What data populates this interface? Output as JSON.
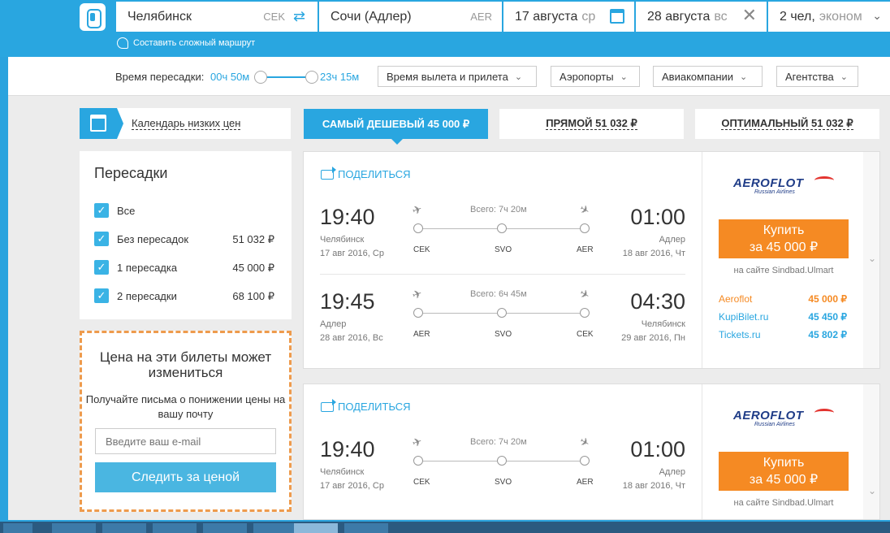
{
  "search": {
    "origin": "Челябинск",
    "origin_code": "CEK",
    "destination": "Сочи (Адлер)",
    "destination_code": "AER",
    "depart_date": "17 августа",
    "depart_day": "ср",
    "return_date": "28 августа",
    "return_day": "вс",
    "passengers": "2 чел,",
    "class": "эконом",
    "complex_route": "Составить сложный маршрут"
  },
  "filters": {
    "transfer_time_label": "Время пересадки:",
    "transfer_min": "00ч 50м",
    "transfer_max": "23ч 15м",
    "dropdowns": [
      "Время вылета и прилета",
      "Аэропорты",
      "Авиакомпании",
      "Агентства"
    ]
  },
  "calendar_link": "Календарь низких цен",
  "tabs": [
    {
      "label": "САМЫЙ ДЕШЕВЫЙ 45 000 ₽",
      "active": true
    },
    {
      "label": "ПРЯМОЙ 51 032 ₽",
      "active": false
    },
    {
      "label": "ОПТИМАЛЬНЫЙ 51 032 ₽",
      "active": false
    }
  ],
  "stops": {
    "title": "Пересадки",
    "items": [
      {
        "label": "Все",
        "price": ""
      },
      {
        "label": "Без пересадок",
        "price": "51 032 ₽"
      },
      {
        "label": "1 пересадка",
        "price": "45 000 ₽"
      },
      {
        "label": "2 пересадки",
        "price": "68 100 ₽"
      }
    ]
  },
  "subscribe": {
    "title": "Цена на эти билеты может измениться",
    "text": "Получайте письма о понижении цены на вашу почту",
    "email_placeholder": "Введите ваш e-mail",
    "button": "Следить за ценой"
  },
  "tickets": [
    {
      "share": "ПОДЕЛИТЬСЯ",
      "segments": [
        {
          "dep_time": "19:40",
          "dep_city": "Челябинск",
          "dep_date": "17 авг 2016, Ср",
          "arr_time": "01:00",
          "arr_city": "Адлер",
          "arr_date": "18 авг 2016, Чт",
          "total": "Всего: 7ч 20м",
          "airports": [
            "CEK",
            "SVO",
            "AER"
          ]
        },
        {
          "dep_time": "19:45",
          "dep_city": "Адлер",
          "dep_date": "28 авг 2016, Вс",
          "arr_time": "04:30",
          "arr_city": "Челябинск",
          "arr_date": "29 авг 2016, Пн",
          "total": "Всего: 6ч 45м",
          "airports": [
            "AER",
            "SVO",
            "CEK"
          ]
        }
      ],
      "airline": "AEROFLOT",
      "airline_sub": "Russian Airlines",
      "buy_line1": "Купить",
      "buy_line2": "за 45 000 ₽",
      "buy_site": "на сайте Sindbad.Ulmart",
      "offers": [
        {
          "agent": "Aeroflot",
          "price": "45 000 ₽"
        },
        {
          "agent": "KupiBilet.ru",
          "price": "45 450 ₽"
        },
        {
          "agent": "Tickets.ru",
          "price": "45 802 ₽"
        }
      ]
    },
    {
      "share": "ПОДЕЛИТЬСЯ",
      "segments": [
        {
          "dep_time": "19:40",
          "dep_city": "Челябинск",
          "dep_date": "17 авг 2016, Ср",
          "arr_time": "01:00",
          "arr_city": "Адлер",
          "arr_date": "18 авг 2016, Чт",
          "total": "Всего: 7ч 20м",
          "airports": [
            "CEK",
            "SVO",
            "AER"
          ]
        }
      ],
      "airline": "AEROFLOT",
      "airline_sub": "Russian Airlines",
      "buy_line1": "Купить",
      "buy_line2": "за 45 000 ₽",
      "buy_site": "на сайте Sindbad.Ulmart"
    }
  ]
}
